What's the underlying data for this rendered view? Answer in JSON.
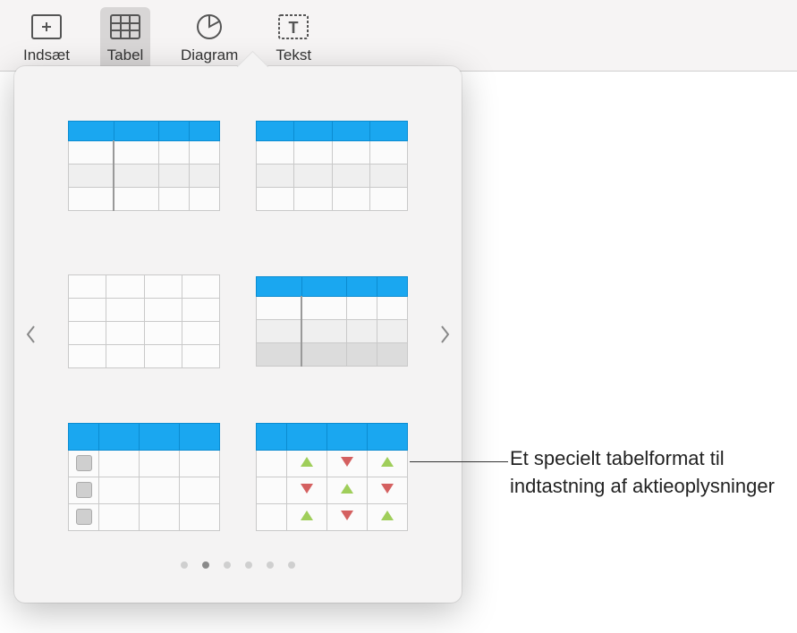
{
  "toolbar": {
    "items": [
      {
        "label": "Indsæt",
        "icon": "insert"
      },
      {
        "label": "Tabel",
        "icon": "table",
        "active": true
      },
      {
        "label": "Diagram",
        "icon": "chart"
      },
      {
        "label": "Tekst",
        "icon": "text"
      }
    ]
  },
  "popover": {
    "table_styles": [
      {
        "name": "header-column-table"
      },
      {
        "name": "header-only-table"
      },
      {
        "name": "plain-table"
      },
      {
        "name": "header-footer-table"
      },
      {
        "name": "checklist-table"
      },
      {
        "name": "stock-table"
      }
    ],
    "page_count": 6,
    "active_page_index": 1
  },
  "callout": {
    "text": "Et specielt tabelformat til indtastning af aktieoplysninger"
  }
}
